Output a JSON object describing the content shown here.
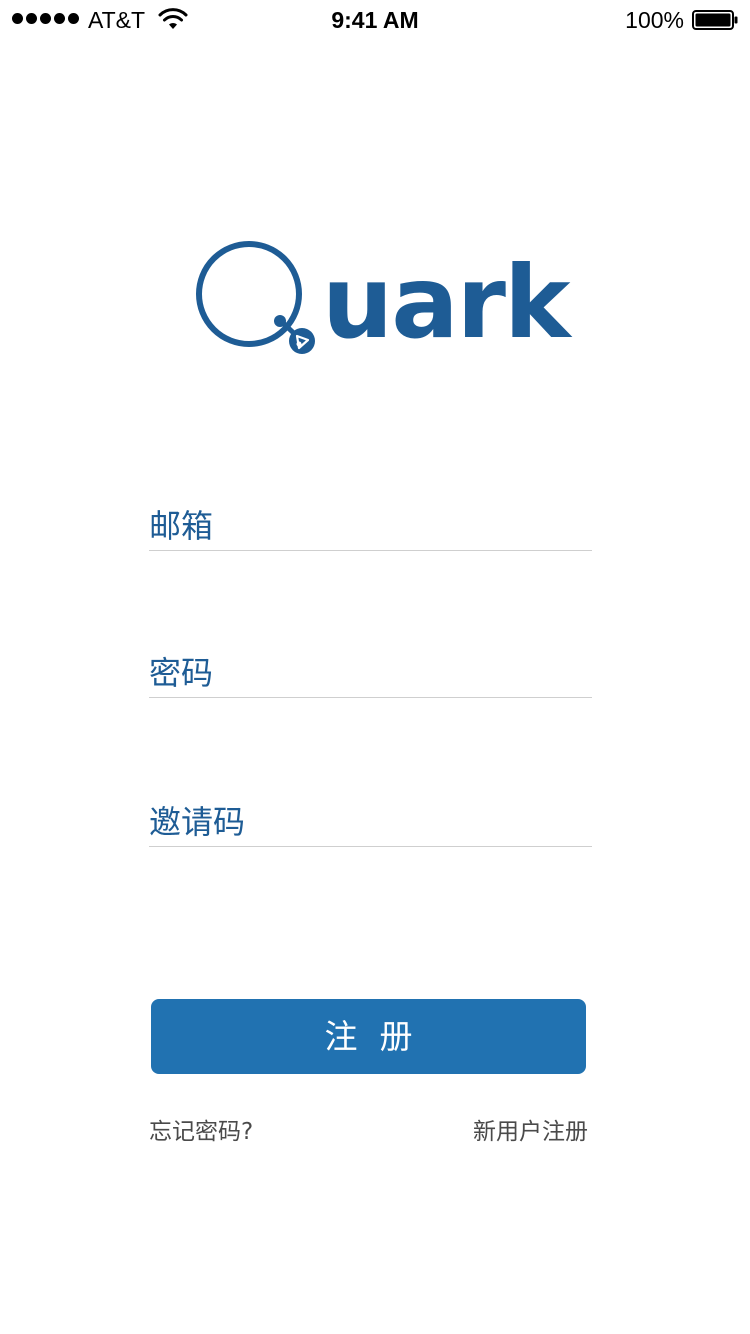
{
  "status_bar": {
    "carrier": "AT&T",
    "time": "9:41 AM",
    "battery_percent": "100%",
    "signal_icon": "signal-dots-icon",
    "wifi_icon": "wifi-icon",
    "battery_icon": "battery-icon"
  },
  "logo": {
    "text": "uark",
    "brand": "Quark",
    "color": "#1e5c95"
  },
  "form": {
    "email_placeholder": "邮箱",
    "password_placeholder": "密码",
    "invite_code_placeholder": "邀请码",
    "submit_label": "注册"
  },
  "links": {
    "forgot_password": "忘记密码?",
    "new_user_signup": "新用户注册"
  },
  "colors": {
    "accent": "#2172b1",
    "label_blue": "#1e5c95",
    "link_gray": "#4a4a4a",
    "divider": "#cfcfcf"
  }
}
